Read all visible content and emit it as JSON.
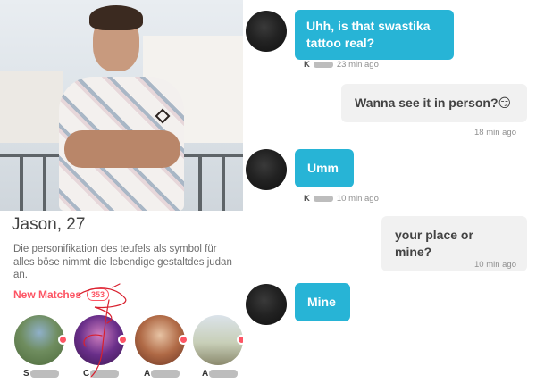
{
  "profile": {
    "name_age": "Jason, 27",
    "bio": "Die personifikation des teufels als symbol für alles böse nimmt die lebendige gestaltdes judan an.",
    "matches_label": "New Matches",
    "matches_count": "353",
    "matches": [
      {
        "initial": "S"
      },
      {
        "initial": "C"
      },
      {
        "initial": "A"
      },
      {
        "initial": "A"
      }
    ]
  },
  "chat": {
    "messages": [
      {
        "direction": "incoming",
        "text": "Uhh, is that swastika tattoo real?",
        "sender_initial": "K",
        "time": "23 min ago"
      },
      {
        "direction": "outgoing",
        "text": "Wanna see it in person?😏",
        "time": "18 min ago"
      },
      {
        "direction": "incoming",
        "text": "Umm",
        "sender_initial": "K",
        "time": "10 min ago"
      },
      {
        "direction": "outgoing",
        "text": "your place or mine?",
        "time": "10 min ago"
      },
      {
        "direction": "incoming",
        "text": "Mine"
      }
    ]
  },
  "colors": {
    "accent_red": "#fd5564",
    "incoming_bubble": "#27b4d6",
    "outgoing_bubble": "#f1f1f1"
  },
  "icons": {
    "presence": "red-dot-icon"
  }
}
